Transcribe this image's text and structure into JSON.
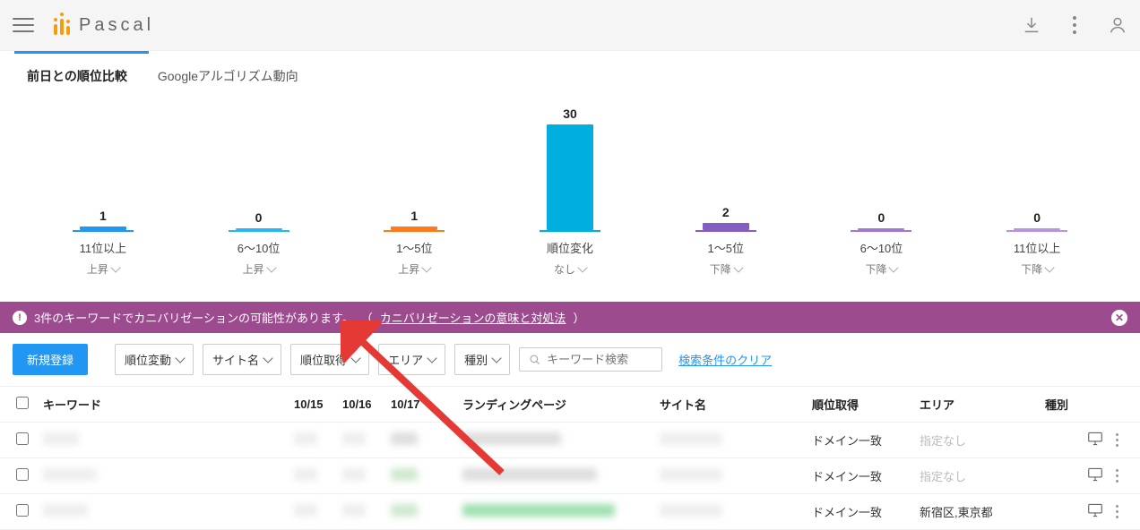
{
  "brand": "Pascal",
  "tabs": {
    "compare": "前日との順位比較",
    "algo": "Googleアルゴリズム動向"
  },
  "chart_data": {
    "type": "bar",
    "title": "",
    "xlabel": "",
    "ylabel": "",
    "ylim": [
      0,
      30
    ],
    "categories": [
      "11位以上",
      "6〜10位",
      "1〜5位",
      "順位変化",
      "1〜5位",
      "6〜10位",
      "11位以上"
    ],
    "subs": [
      "上昇",
      "上昇",
      "上昇",
      "なし",
      "下降",
      "下降",
      "下降"
    ],
    "values": [
      1,
      0,
      1,
      30,
      2,
      0,
      0
    ],
    "bar_colors": [
      "#2196f3",
      "#29b6f6",
      "#ff7a1a",
      "#00aee0",
      "#845ec2",
      "#a078d1",
      "#b894e0"
    ],
    "underline_colors": [
      "#2196f3",
      "#29b6f6",
      "#ff7a1a",
      "#00aee0",
      "#845ec2",
      "#a078d1",
      "#b894e0"
    ]
  },
  "alert": {
    "text": "3件のキーワードでカニバリゼーションの可能性があります。",
    "paren_open": "（ ",
    "link": "カニバリゼーションの意味と対処法",
    "paren_close": " ）"
  },
  "toolbar": {
    "new": "新規登録",
    "filters": [
      "順位変動",
      "サイト名",
      "順位取得",
      "エリア",
      "種別"
    ],
    "search_placeholder": "キーワード検索",
    "clear": "検索条件のクリア"
  },
  "table": {
    "headers": {
      "keyword": "キーワード",
      "d1": "10/15",
      "d2": "10/16",
      "d3": "10/17",
      "landing": "ランディングページ",
      "site": "サイト名",
      "rank": "順位取得",
      "area": "エリア",
      "type": "種別"
    },
    "rows": [
      {
        "rank": "ドメイン一致",
        "area": "指定なし",
        "area_muted": true
      },
      {
        "rank": "ドメイン一致",
        "area": "指定なし",
        "area_muted": true
      },
      {
        "rank": "ドメイン一致",
        "area": "新宿区,東京都",
        "area_muted": false
      }
    ]
  }
}
